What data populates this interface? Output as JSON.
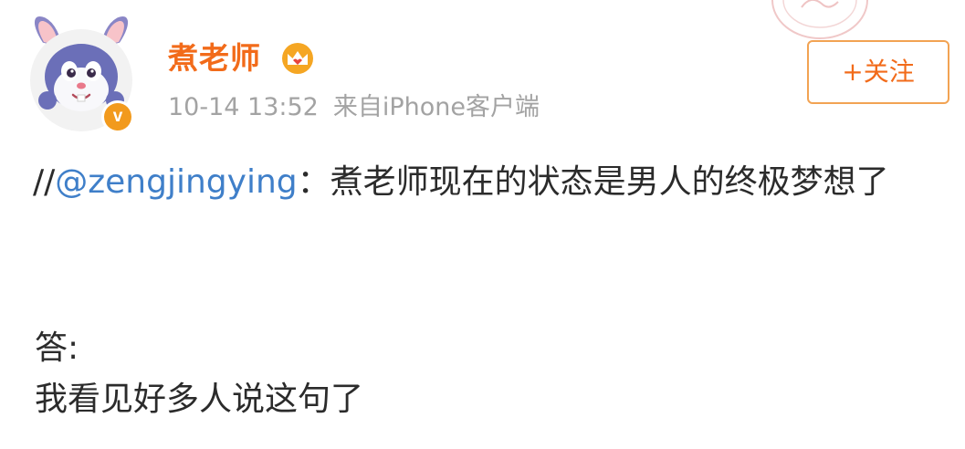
{
  "post": {
    "author_name": "煮老师",
    "timestamp": "10-14 13:52",
    "source": "来自iPhone客户端",
    "follow_label": "+关注",
    "verified_badge": "v",
    "icons": {
      "avatar": "bunny-avatar-icon",
      "crown": "crown-icon",
      "verified": "verified-icon"
    },
    "content": {
      "prefix": "//",
      "mention": "@zengjingying",
      "separator": "：",
      "quote_text": "煮老师现在的状态是男人的终极梦想了",
      "answer_label": "答:",
      "answer_text": "我看见好多人说这句了"
    }
  },
  "colors": {
    "author_name": "#f26b1a",
    "mention_link": "#3f7fc9",
    "follow_border": "#f2a353",
    "meta_gray": "#a3a3a3",
    "verified_badge": "#f29a1d"
  }
}
